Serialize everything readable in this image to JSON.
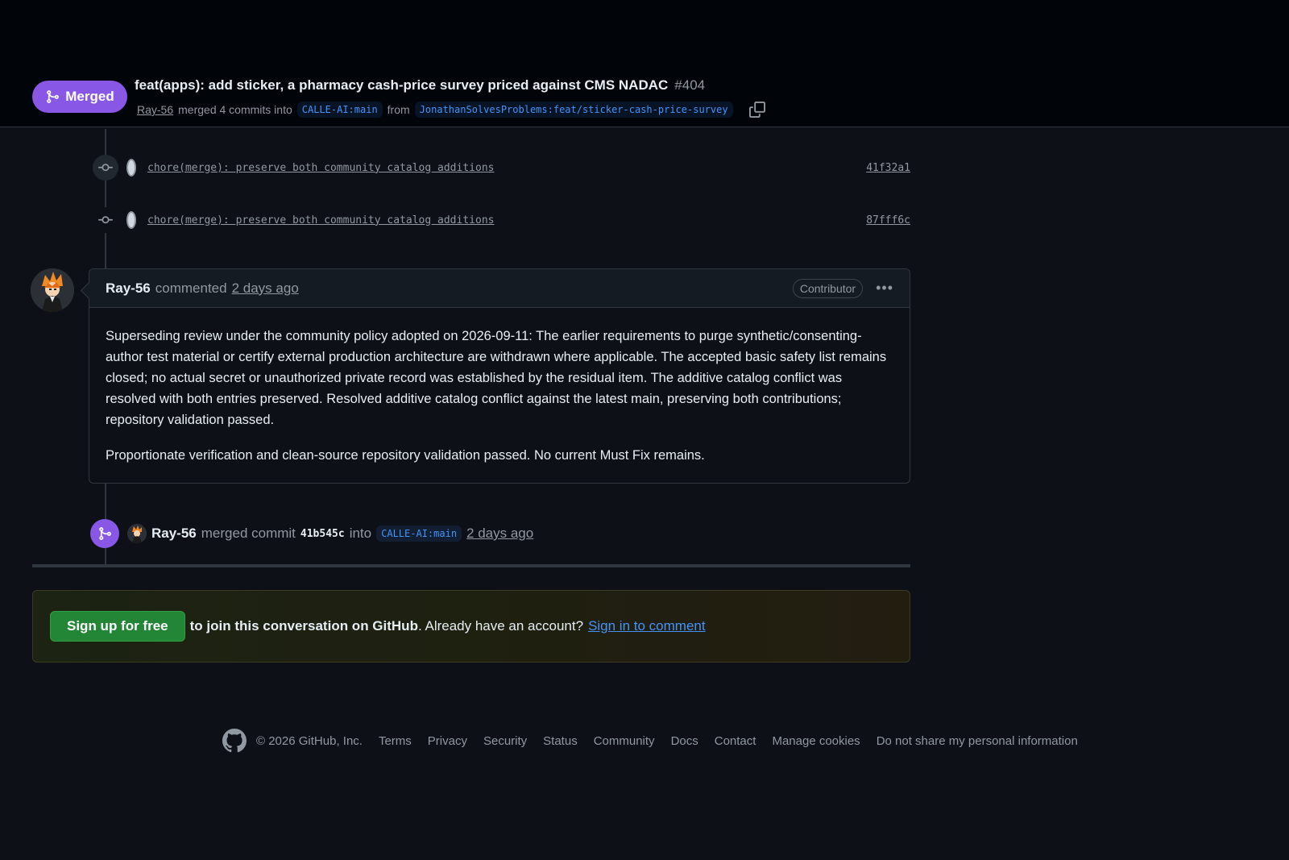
{
  "header": {
    "status_label": "Merged",
    "title": "feat(apps): add sticker, a pharmacy cash-price survey priced against CMS NADAC",
    "number": "#404",
    "author": "Ray-56",
    "merged_text": "merged 4 commits into",
    "base_branch": "CALLE-AI:main",
    "from_text": "from",
    "head_branch": "JonathanSolvesProblems:feat/sticker-cash-price-survey"
  },
  "commits": [
    {
      "message": "chore(merge): preserve both community catalog additions",
      "sha": "41f32a1"
    },
    {
      "message": "chore(merge): preserve both community catalog additions",
      "sha": "87fff6c"
    }
  ],
  "comment": {
    "author": "Ray-56",
    "action": "commented",
    "time": "2 days ago",
    "badge": "Contributor",
    "menu_icon": "kebab-horizontal-icon",
    "paragraphs": [
      "Superseding review under the community policy adopted on 2026-09-11: The earlier requirements to purge synthetic/consenting-author test material or certify external production architecture are withdrawn where applicable. The accepted basic safety list remains closed; no actual secret or unauthorized private record was established by the residual item. The additive catalog conflict was resolved with both entries preserved. Resolved additive catalog conflict against the latest main, preserving both contributions; repository validation passed.",
      "Proportionate verification and clean-source repository validation passed. No current Must Fix remains."
    ]
  },
  "merge_event": {
    "author": "Ray-56",
    "action": "merged commit",
    "sha": "41b545c",
    "into": "into",
    "branch": "CALLE-AI:main",
    "time": "2 days ago"
  },
  "signup": {
    "button": "Sign up for free",
    "strong_text": "to join this conversation on GitHub",
    "rest_text": ". Already have an account?",
    "signin_link": "Sign in to comment"
  },
  "footer": {
    "copyright": "© 2026 GitHub, Inc.",
    "links": [
      "Terms",
      "Privacy",
      "Security",
      "Status",
      "Community",
      "Docs",
      "Contact",
      "Manage cookies",
      "Do not share my personal information"
    ]
  },
  "colors": {
    "background": "#0d1117",
    "merged_purple": "#8957e5",
    "link_blue": "#4493f8",
    "signup_green": "#238636"
  }
}
